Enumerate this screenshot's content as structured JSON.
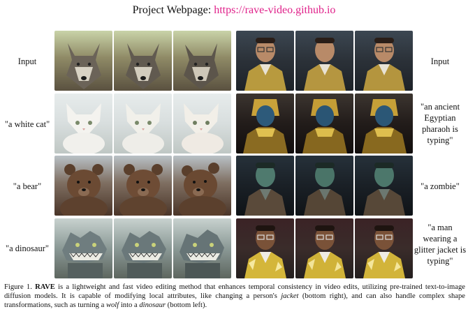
{
  "header": {
    "prefix": "Project Webpage:",
    "url": "https://rave-video.github.io"
  },
  "left_labels": [
    "Input",
    "\"a white cat\"",
    "\"a bear\"",
    "\"a dinosaur\""
  ],
  "right_labels": [
    "Input",
    "\"an ancient Egyptian pharaoh is typing\"",
    "\"a zombie\"",
    "\"a man wearing a glitter jacket is typing\""
  ],
  "caption": {
    "figure_label": "Figure 1.",
    "method_name": "RAVE",
    "text_1": " is a lightweight and fast video editing method that enhances temporal consistency in video edits, utilizing pre-trained text-to-image diffusion models.  It is capable of modifying local attributes, like changing a person's ",
    "jacket_word": "jacket",
    "text_2": " (bottom right), and can also handle complex shape transformations, such as turning a ",
    "wolf_word": "wolf",
    "text_3": " into a ",
    "dinosaur_word": "dinosaur",
    "text_4": " (bottom left)."
  },
  "images": {
    "left_rows": [
      "wolf",
      "white-cat",
      "bear",
      "dinosaur"
    ],
    "right_rows": [
      "man-input",
      "pharaoh",
      "zombie",
      "glitter-jacket-man"
    ],
    "frames_per_row": 3
  },
  "colors": {
    "link": "#e0218a"
  }
}
